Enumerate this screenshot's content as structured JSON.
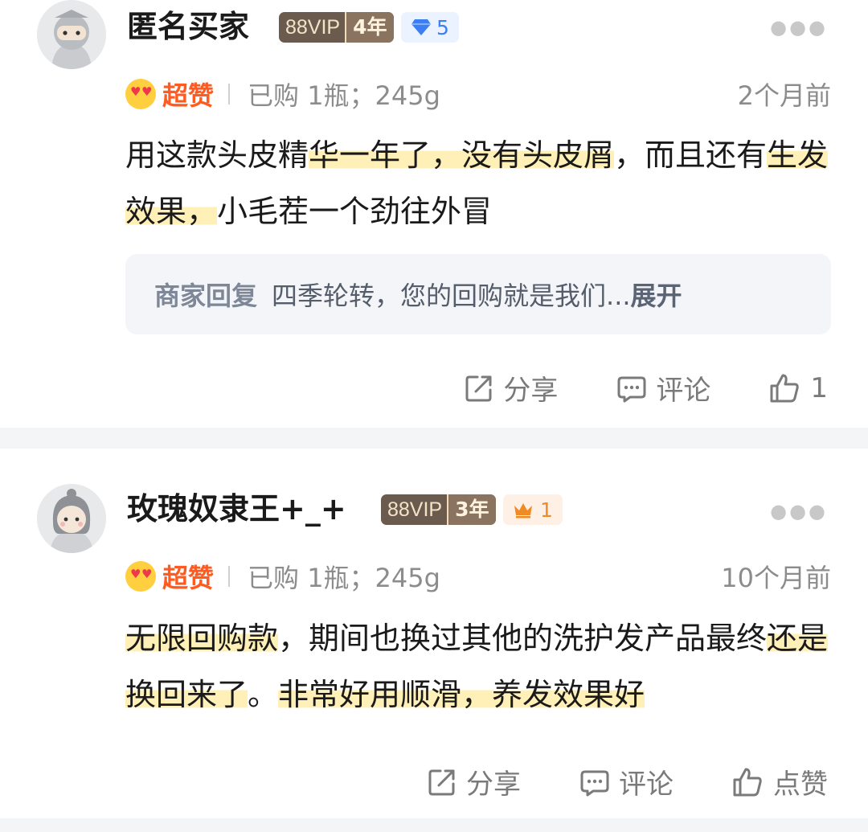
{
  "reviews": [
    {
      "username": "匿名买家",
      "vip_label": "88VIP",
      "vip_years": "4年",
      "level_icon": "diamond-icon",
      "level_value": "5",
      "rating_label": "超赞",
      "purchase_info": "已购 1瓶；245g",
      "time": "2个月前",
      "content_parts": [
        "用这款头皮精",
        "华一年了，没有头皮屑",
        "，而且还有",
        "生发效果，",
        "小毛茬一个劲往外冒"
      ],
      "reply": {
        "label": "商家回复",
        "text": "四季轮转，您的回购就是我们...",
        "expand": "展开"
      },
      "actions": {
        "share": "分享",
        "comment": "评论",
        "like": "1"
      }
    },
    {
      "username": "玫瑰奴隶王+_+",
      "vip_label": "88VIP",
      "vip_years": "3年",
      "level_icon": "crown-icon",
      "level_value": "1",
      "rating_label": "超赞",
      "purchase_info": "已购 1瓶；245g",
      "time": "10个月前",
      "content_parts": [
        "无限回购款",
        "，期间也换过其他的洗护发产品最终",
        "还是换回来了",
        "。",
        "非常好用顺滑，养发效果好"
      ],
      "actions": {
        "share": "分享",
        "comment": "评论",
        "like": "点赞"
      }
    }
  ],
  "colors": {
    "rating_orange": "#ff5a1f",
    "highlight": "#fff0b8",
    "vip_brown": "#6b5b4f",
    "separator": "#f4f5f7"
  }
}
